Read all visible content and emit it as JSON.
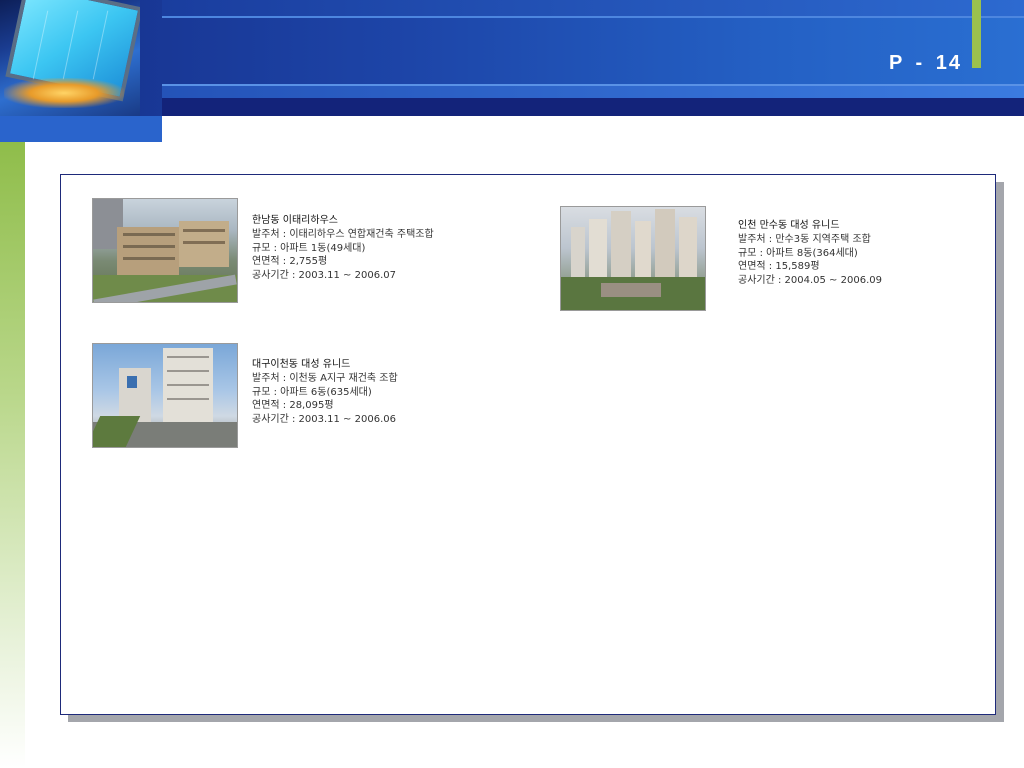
{
  "header": {
    "page_number": "P - 14"
  },
  "projects": [
    {
      "title": "한남동 이태리하우스",
      "client": "발주처 : 이태리하우스 연합재건축 주택조합",
      "scale": "규모 : 아파트 1동(49세대)",
      "area": "연면적 :    2,755평",
      "period": "공사기간 : 2003.11 ~ 2006.07"
    },
    {
      "title": "인천 만수동 대성 유니드",
      "client": "발주처 : 만수3동 지역주택 조합",
      "scale": "규모 : 아파트 8동(364세대)",
      "area": "연면적 :  15,589평",
      "period": "공사기간 : 2004.05 ~ 2006.09"
    },
    {
      "title": "대구이천동 대성 유니드",
      "client": "발주처 : 이천동 A지구 재건축 조합",
      "scale": "규모 : 아파트 6동(635세대)",
      "area": "연면적 :  28,095평",
      "period": "공사기간 : 2003.11 ~ 2006.06"
    }
  ]
}
